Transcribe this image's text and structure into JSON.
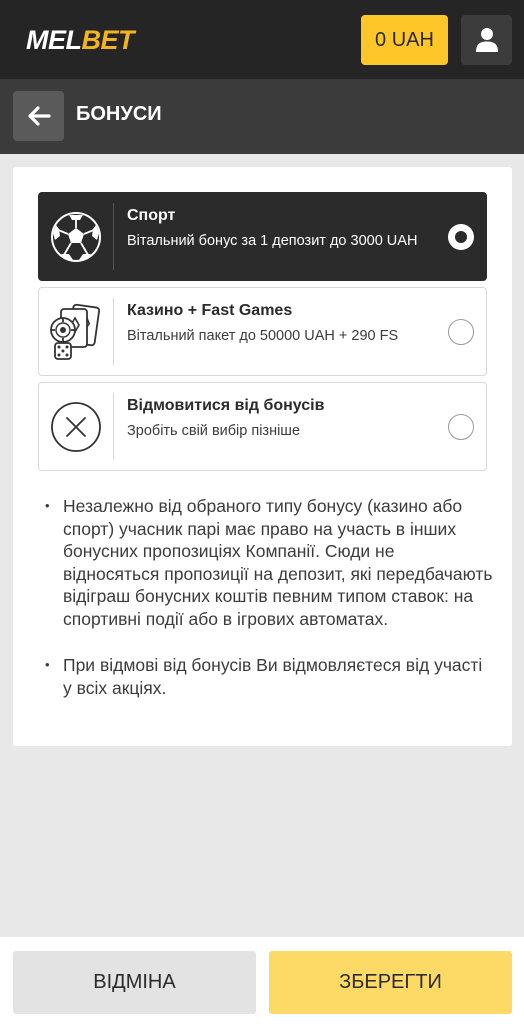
{
  "header": {
    "logo_part1": "MEL",
    "logo_part2": "BET",
    "balance": "0 UAH",
    "profile_icon": "user-icon"
  },
  "titlebar": {
    "back_icon": "arrow-left-icon",
    "title": "БОНУСИ"
  },
  "options": [
    {
      "title": "Спорт",
      "desc": "Вітальний бонус за 1 депозит до 3000 UAH",
      "icon": "soccer-ball-icon",
      "selected": true
    },
    {
      "title": "Казино + Fast Games",
      "desc": "Вітальний пакет до 50000 UAH + 290 FS",
      "icon": "casino-cards-dice-icon",
      "selected": false
    },
    {
      "title": "Відмовитися від бонусів",
      "desc": "Зробіть свій вибір пізніше",
      "icon": "close-circle-icon",
      "selected": false
    }
  ],
  "notes": [
    "Незалежно від обраного типу бонусу (казино або спорт) учасник парі має право на участь в інших бонусних пропозиціях Компанії. Сюди не відносяться пропозиції на депозит, які передбачають відіграш бонусних коштів певним типом ставок: на спортивні події або в ігрових автоматах.",
    "При відмові від бонусів Ви відмовляєтеся від участі у всіх акціях."
  ],
  "footer": {
    "cancel_label": "ВІДМІНА",
    "save_label": "ЗБЕРЕГТИ"
  },
  "colors": {
    "accent": "#ffc629",
    "save_button": "#fdda66",
    "dark": "#2b2b2b"
  }
}
